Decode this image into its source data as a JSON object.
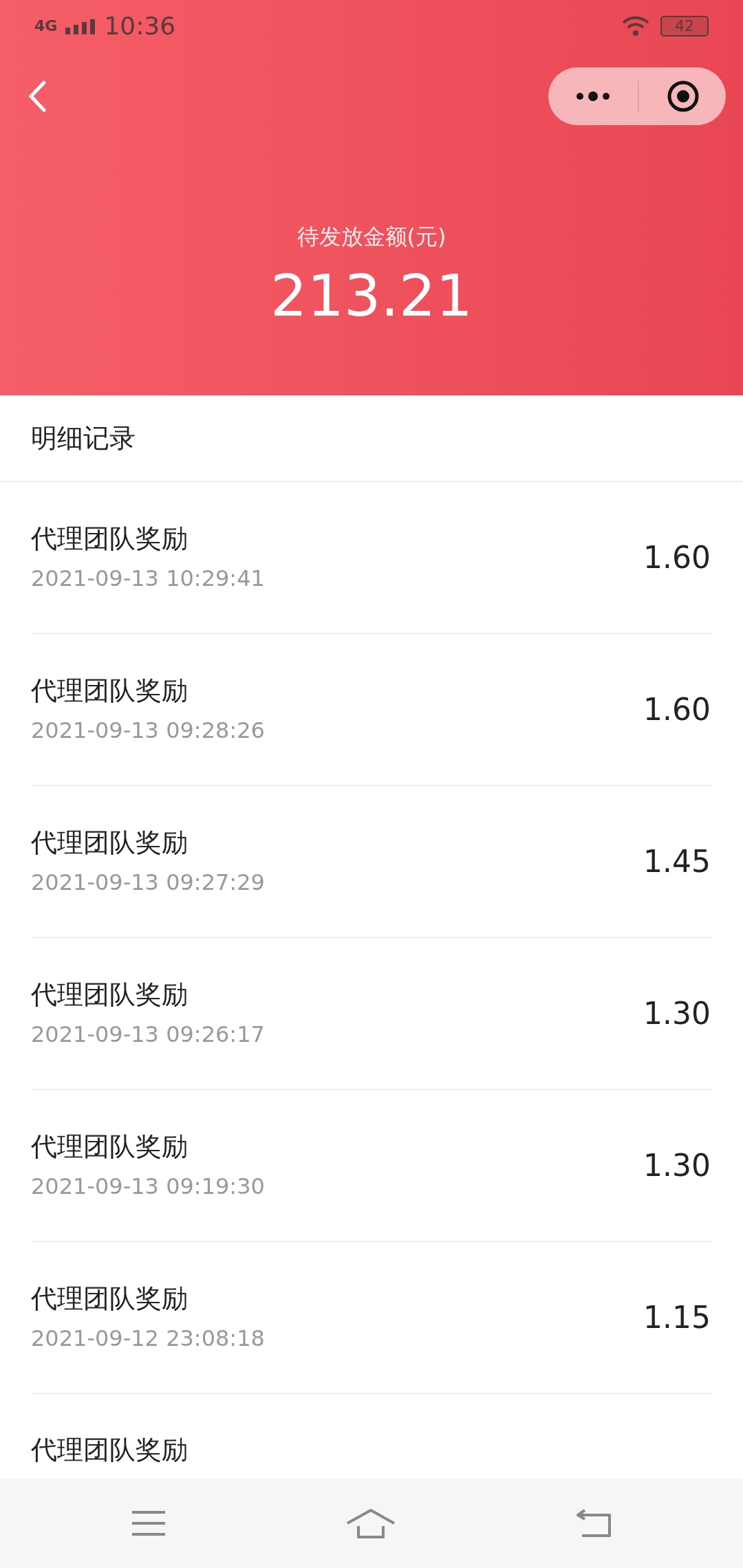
{
  "status_bar": {
    "network": "4G",
    "time": "10:36",
    "battery": "42"
  },
  "header": {
    "label": "待发放金额(元)",
    "amount": "213.21"
  },
  "section": {
    "title": "明细记录"
  },
  "records": [
    {
      "title": "代理团队奖励",
      "time": "2021-09-13 10:29:41",
      "amount": "1.60"
    },
    {
      "title": "代理团队奖励",
      "time": "2021-09-13 09:28:26",
      "amount": "1.60"
    },
    {
      "title": "代理团队奖励",
      "time": "2021-09-13 09:27:29",
      "amount": "1.45"
    },
    {
      "title": "代理团队奖励",
      "time": "2021-09-13 09:26:17",
      "amount": "1.30"
    },
    {
      "title": "代理团队奖励",
      "time": "2021-09-13 09:19:30",
      "amount": "1.30"
    },
    {
      "title": "代理团队奖励",
      "time": "2021-09-12 23:08:18",
      "amount": "1.15"
    },
    {
      "title": "代理团队奖励"
    }
  ]
}
